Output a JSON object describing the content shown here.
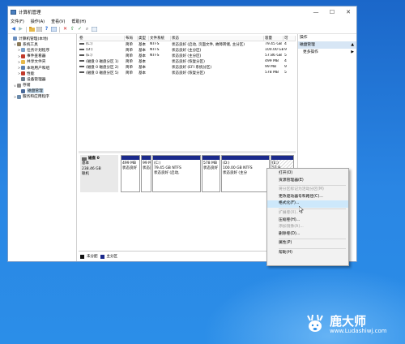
{
  "window": {
    "title": "计算机管理",
    "controls": {
      "minimize": "—",
      "maximize": "☐",
      "close": "✕"
    }
  },
  "menubar": [
    "文件(F)",
    "操作(A)",
    "查看(V)",
    "帮助(H)"
  ],
  "toolbar_icons": [
    "back-icon",
    "forward-icon",
    "folder-icon",
    "list-icon",
    "help-icon",
    "properties-icon",
    "delete-icon",
    "export-icon",
    "check-icon",
    "search-icon",
    "refresh-icon"
  ],
  "tree": [
    {
      "label": "计算机管理(本地)",
      "arrow": "",
      "icon": "computer-icon",
      "color": "#6b8fbf",
      "indent": 0
    },
    {
      "label": "系统工具",
      "arrow": "∨",
      "icon": "tools-icon",
      "color": "#8a7a5a",
      "indent": 1
    },
    {
      "label": "任务计划程序",
      "arrow": ">",
      "icon": "clock-icon",
      "color": "#7aa0c8",
      "indent": 2
    },
    {
      "label": "事件查看器",
      "arrow": ">",
      "icon": "event-icon",
      "color": "#c0392b",
      "indent": 2
    },
    {
      "label": "共享文件夹",
      "arrow": ">",
      "icon": "folder-icon",
      "color": "#e6b84a",
      "indent": 2
    },
    {
      "label": "本地用户和组",
      "arrow": ">",
      "icon": "users-icon",
      "color": "#5a7fb0",
      "indent": 2
    },
    {
      "label": "性能",
      "arrow": ">",
      "icon": "gauge-icon",
      "color": "#c0392b",
      "indent": 2
    },
    {
      "label": "设备管理器",
      "arrow": "",
      "icon": "device-icon",
      "color": "#6a7a8a",
      "indent": 2
    },
    {
      "label": "存储",
      "arrow": "∨",
      "icon": "storage-icon",
      "color": "#8a8a8a",
      "indent": 1
    },
    {
      "label": "磁盘管理",
      "arrow": "",
      "icon": "disk-icon",
      "color": "#4a6a9a",
      "indent": 2,
      "selected": true
    },
    {
      "label": "服务和应用程序",
      "arrow": ">",
      "icon": "services-icon",
      "color": "#6a8aaa",
      "indent": 1
    }
  ],
  "volume_table": {
    "headers": [
      "卷",
      "布局",
      "类型",
      "文件系统",
      "状态",
      "容量",
      "可"
    ],
    "rows": [
      [
        "(C:)",
        "简单",
        "基本",
        "NTFS",
        "状态良好 (启动, 页面文件, 故障转储, 主分区)",
        "79.45 GB",
        "4"
      ],
      [
        "(D:)",
        "简单",
        "基本",
        "NTFS",
        "状态良好 (主分区)",
        "100.00 GB",
        "9"
      ],
      [
        "(E:)",
        "简单",
        "基本",
        "NTFS",
        "状态良好 (主分区)",
        "57.86 GB",
        "5"
      ],
      [
        "(磁盘 0 磁盘分区 1)",
        "简单",
        "基本",
        "",
        "状态良好 (恢复分区)",
        "499 MB",
        "4"
      ],
      [
        "(磁盘 0 磁盘分区 2)",
        "简单",
        "基本",
        "",
        "状态良好 (EFI 系统分区)",
        "99 MB",
        "9"
      ],
      [
        "(磁盘 0 磁盘分区 5)",
        "简单",
        "基本",
        "",
        "状态良好 (恢复分区)",
        "578 MB",
        "5"
      ]
    ]
  },
  "disk": {
    "name": "磁盘 0",
    "type": "基本",
    "size": "238.46 GB",
    "status": "联机",
    "partitions": [
      {
        "name": "",
        "size": "499 MB",
        "status": "状态良好"
      },
      {
        "name": "",
        "size": "99 M",
        "status": "状态良"
      },
      {
        "name": "(C:)",
        "size": "79.45 GB NTFS",
        "status": "状态良好 (启动,"
      },
      {
        "name": "",
        "size": "578 MB",
        "status": "状态良好"
      },
      {
        "name": "(D:)",
        "size": "100.00 GB NTFS",
        "status": "状态良好 (主分"
      },
      {
        "name": "(E:)",
        "size": "57.8",
        "status": "状态"
      }
    ]
  },
  "legend": [
    {
      "label": "未分配",
      "color": "#111111"
    },
    {
      "label": "主分区",
      "color": "#1b2a8c"
    }
  ],
  "actions": {
    "header": "操作",
    "section": "磁盘管理",
    "section_arrow": "▲",
    "more": "更多操作",
    "more_arrow": "▶"
  },
  "context_menu": [
    {
      "label": "打开(O)",
      "disabled": false
    },
    {
      "label": "资源管理器(E)",
      "disabled": false
    },
    {
      "sep": true
    },
    {
      "label": "将分区标记为活动分区(M)",
      "disabled": true
    },
    {
      "label": "更改驱动器号和路径(C)...",
      "disabled": false
    },
    {
      "label": "格式化(F)...",
      "disabled": false,
      "highlight": true
    },
    {
      "sep": true
    },
    {
      "label": "扩展卷(X)...",
      "disabled": true
    },
    {
      "label": "压缩卷(H)...",
      "disabled": false
    },
    {
      "label": "添加镜像(A)...",
      "disabled": true
    },
    {
      "label": "删除卷(D)...",
      "disabled": false
    },
    {
      "sep": true
    },
    {
      "label": "属性(P)",
      "disabled": false
    },
    {
      "sep": true
    },
    {
      "label": "帮助(H)",
      "disabled": false
    }
  ],
  "watermark": {
    "title": "鹿大师",
    "url": "www.Ludashiwj.com"
  }
}
